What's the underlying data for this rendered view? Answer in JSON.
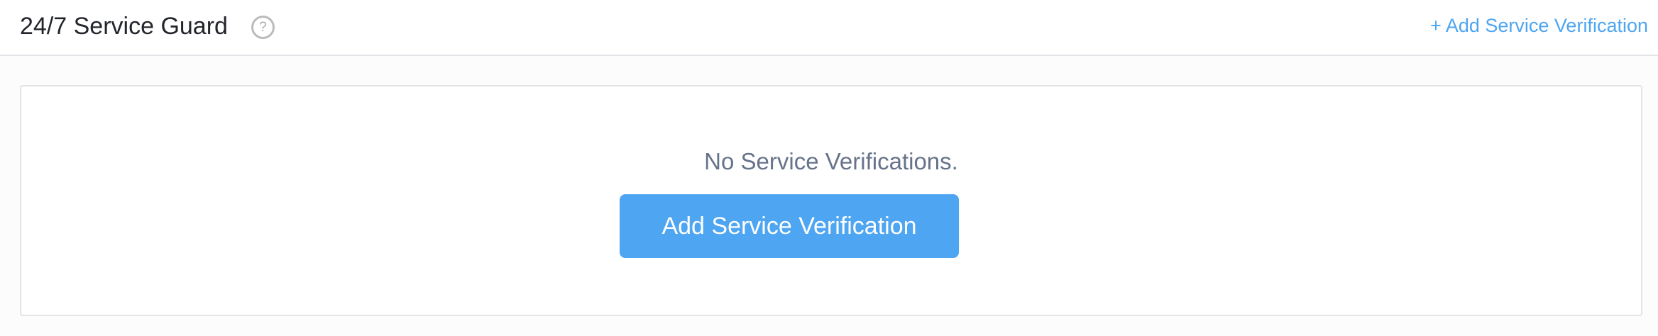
{
  "header": {
    "title": "24/7 Service Guard",
    "help_icon": "question-circle-icon",
    "help_glyph": "?",
    "add_link": "+ Add Service Verification"
  },
  "empty_state": {
    "message": "No Service Verifications.",
    "button_label": "Add Service Verification"
  },
  "colors": {
    "accent": "#4ea5f1",
    "muted_text": "#66738a",
    "title": "#22252b"
  }
}
